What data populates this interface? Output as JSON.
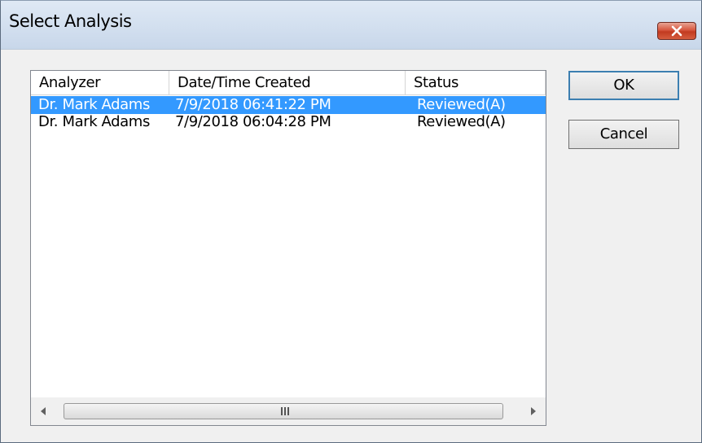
{
  "window": {
    "title": "Select Analysis"
  },
  "columns": [
    "Analyzer",
    "Date/Time Created",
    "Status"
  ],
  "rows": [
    {
      "analyzer": "Dr. Mark Adams",
      "created": "7/9/2018 06:41:22 PM",
      "status": "Reviewed(A)",
      "selected": true
    },
    {
      "analyzer": "Dr. Mark Adams",
      "created": "7/9/2018 06:04:28 PM",
      "status": "Reviewed(A)",
      "selected": false
    }
  ],
  "buttons": {
    "ok": "OK",
    "cancel": "Cancel"
  },
  "colors": {
    "selection": "#3399ff",
    "close_button": "#c7432a"
  },
  "icons": {
    "close": "close-icon",
    "scroll_left": "scroll-left-arrow-icon",
    "scroll_right": "scroll-right-arrow-icon"
  }
}
